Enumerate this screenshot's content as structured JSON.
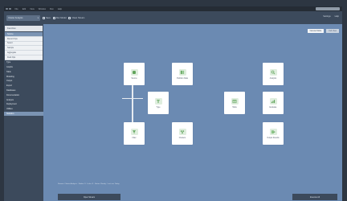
{
  "menubar": {
    "items": [
      "File",
      "Edit",
      "View",
      "Window",
      "Run",
      "Help"
    ]
  },
  "toolbar": {
    "project": "Cluster Analysis",
    "buttons": [
      "Save",
      "Run Model",
      "Clean Stream"
    ],
    "right": [
      "Settings",
      "Help"
    ]
  },
  "sidebar": {
    "header": "Favorites",
    "items": [
      "Source",
      "Record Ops",
      "Select",
      "Sample",
      "Aggregate",
      "Field Ops",
      "Type",
      "Graphs",
      "Table",
      "Modeling",
      "Output",
      "Export",
      "Databases",
      "Documentation",
      "Analysis",
      "Deployment",
      "Utilities",
      "Statistics"
    ]
  },
  "canvas": {
    "view_buttons": [
      "Canvas Mode",
      "Full View"
    ],
    "nodes": [
      {
        "id": "n1",
        "label": "Source"
      },
      {
        "id": "n2",
        "label": "Partition Data"
      },
      {
        "id": "n3",
        "label": "Type"
      },
      {
        "id": "n4",
        "label": "Filter"
      },
      {
        "id": "n5",
        "label": "Clusters"
      },
      {
        "id": "n6",
        "label": "Table"
      },
      {
        "id": "n7",
        "label": "Analysis"
      },
      {
        "id": "n8",
        "label": "Evaluate"
      },
      {
        "id": "n9",
        "label": "Output Results"
      }
    ],
    "status_line": "Stream: Cluster Analysis · Nodes: 9 · Links: 8 · Status: Ready · Last run: Today",
    "bottom_left": "Open Stream",
    "bottom_right": "Execute All"
  },
  "colors": {
    "canvas": "#6b8ab2",
    "sidebar": "#3c4a5c",
    "node": "#ffffff",
    "icon_bg": "#dfeede",
    "icon_fg": "#5fa35a"
  }
}
